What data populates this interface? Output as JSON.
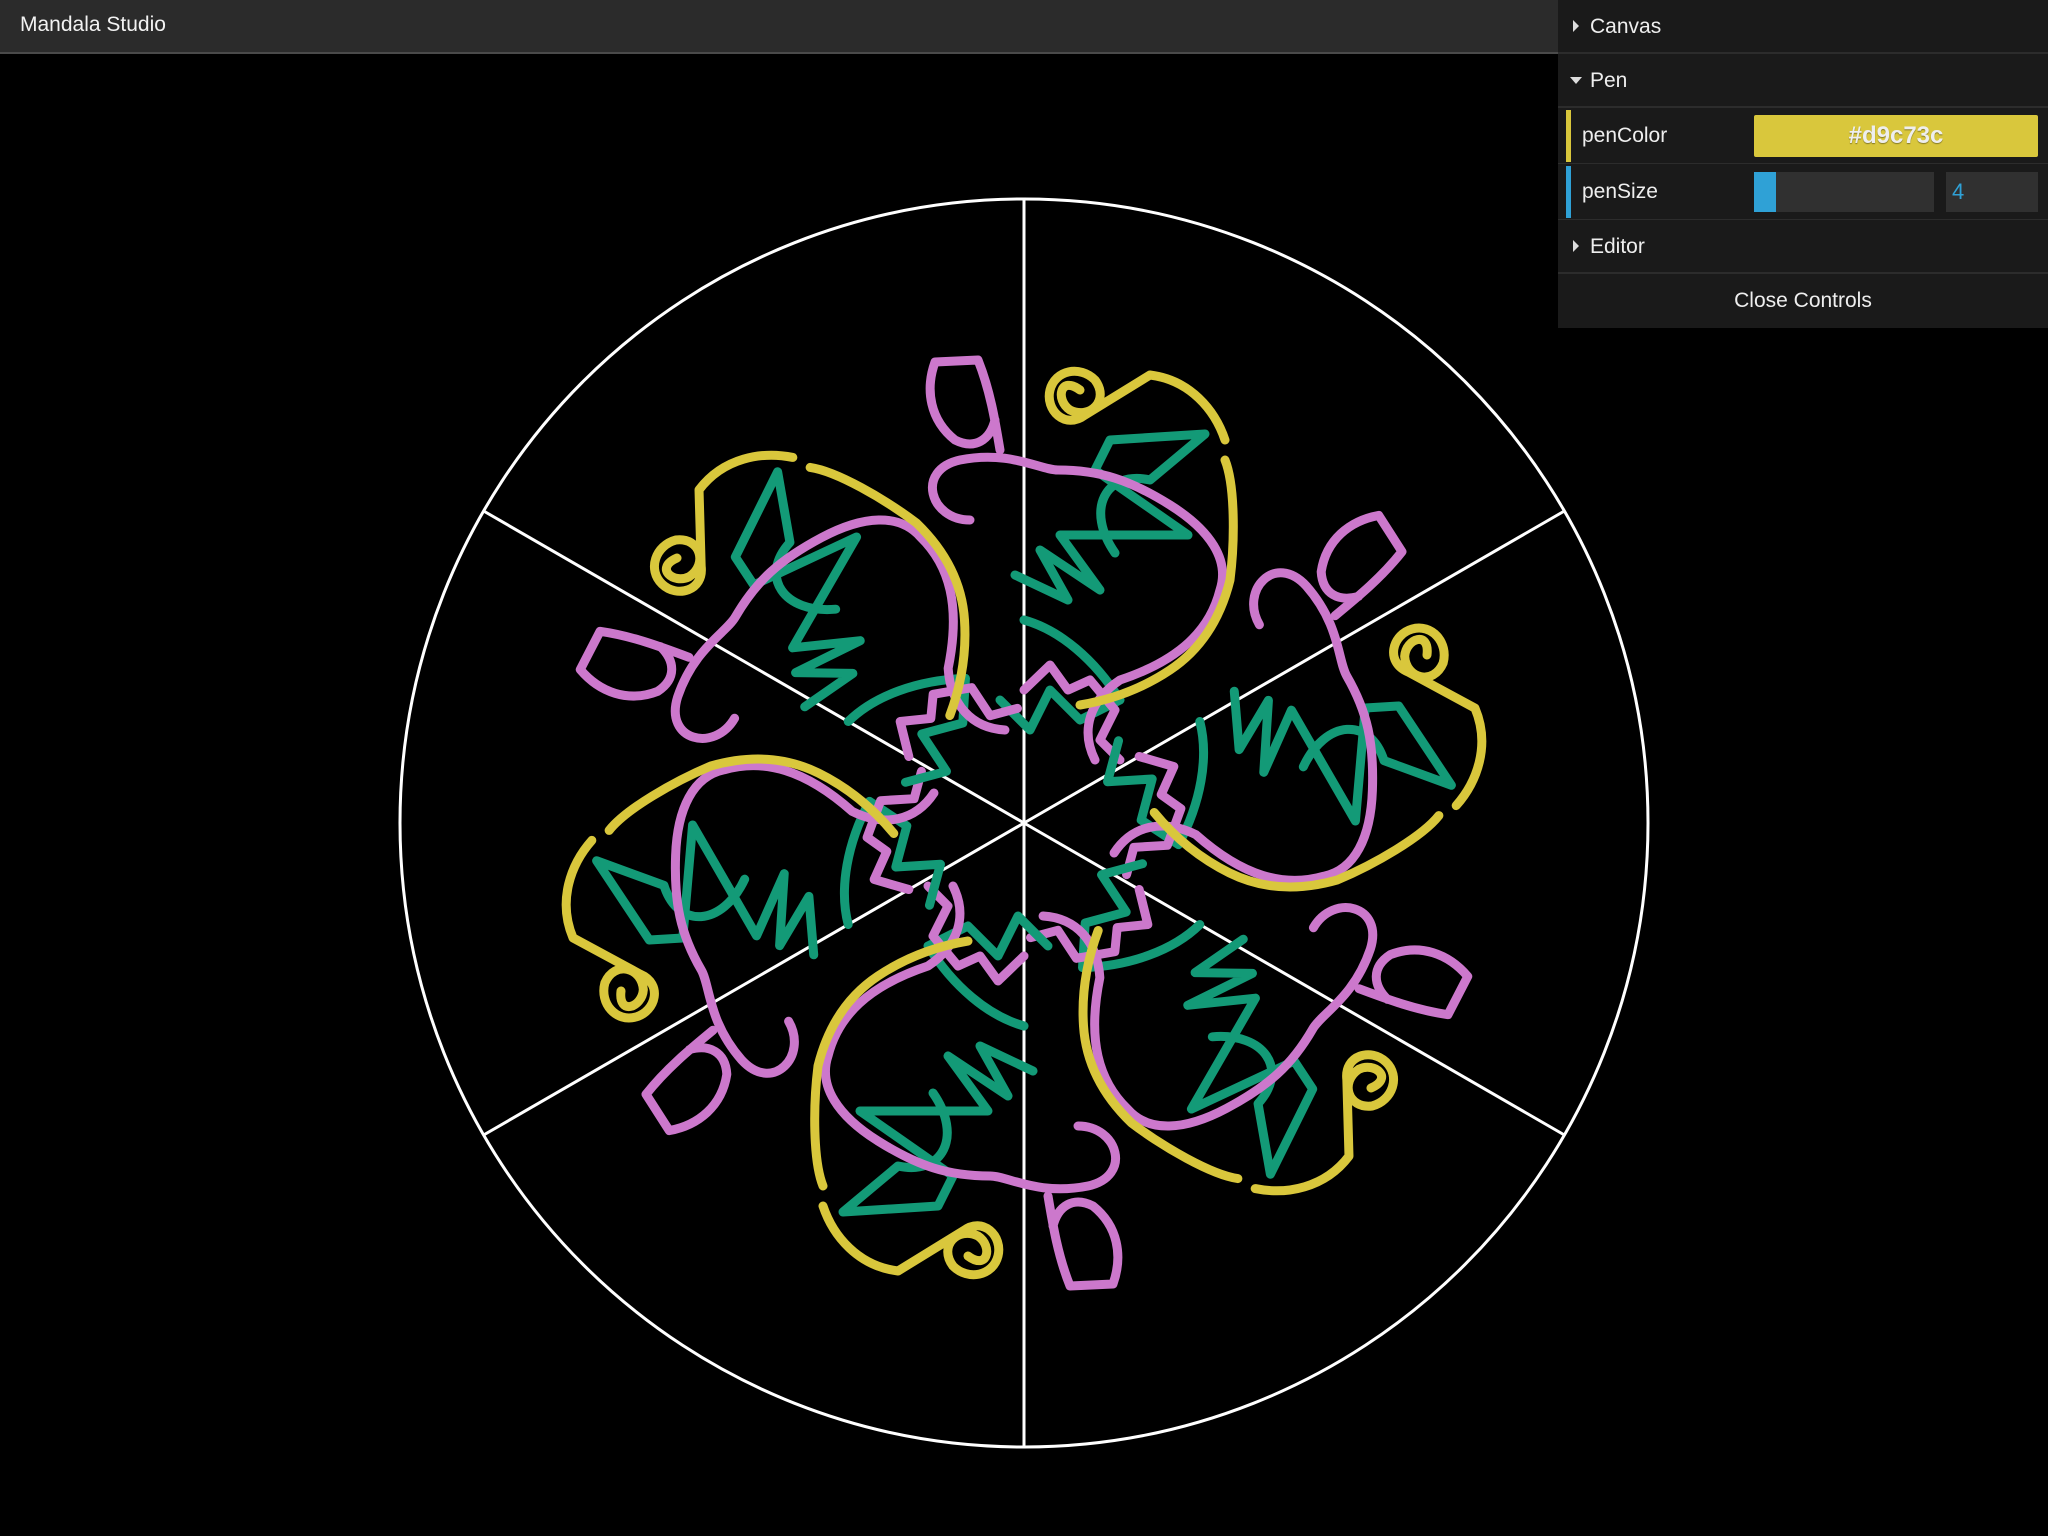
{
  "app": {
    "title": "Mandala Studio"
  },
  "gui": {
    "folders": {
      "canvas": {
        "label": "Canvas",
        "open": false
      },
      "pen": {
        "label": "Pen",
        "open": true
      },
      "editor": {
        "label": "Editor",
        "open": false
      }
    },
    "pen": {
      "color_label": "penColor",
      "color_value": "#d9c73c",
      "size_label": "penSize",
      "size_value": "4",
      "size_fraction": 0.12
    },
    "close_label": "Close Controls"
  },
  "mandala": {
    "segments": 6,
    "guide_color": "#ffffff",
    "stroke_colors": {
      "teal": "#139a77",
      "pink": "#cc78cc",
      "yellow": "#d9c73c"
    }
  },
  "colors": {
    "titlebar_bg": "#2b2b2b",
    "panel_bg": "#1a1a1a",
    "color_stripe": "#d9c73c",
    "number_stripe": "#2fa1d6",
    "accent_blue": "#2fa1d6"
  }
}
